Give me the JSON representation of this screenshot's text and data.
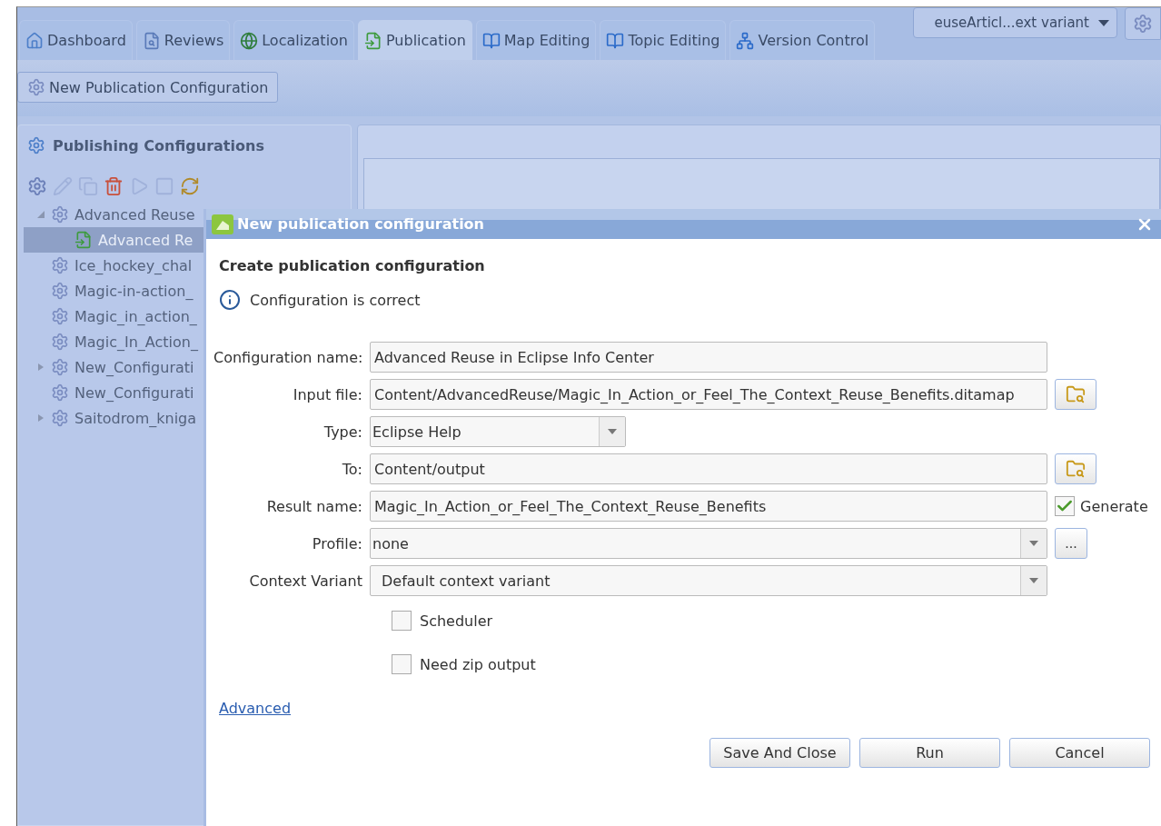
{
  "tabs": [
    {
      "label": "Dashboard",
      "kind": "home",
      "selected": false
    },
    {
      "label": "Reviews",
      "kind": "review",
      "selected": false
    },
    {
      "label": "Localization",
      "kind": "globe",
      "selected": false
    },
    {
      "label": "Publication",
      "kind": "publish",
      "selected": true
    },
    {
      "label": "Map Editing",
      "kind": "book",
      "selected": false
    },
    {
      "label": "Topic Editing",
      "kind": "book",
      "selected": false
    },
    {
      "label": "Version Control",
      "kind": "network",
      "selected": false
    }
  ],
  "context_selector": {
    "value": "euseArticl...ext variant"
  },
  "toolbar": {
    "button": "New Publication Configuration"
  },
  "panel": {
    "title": "Publishing Configurations",
    "tools": [
      {
        "kind": "add",
        "disabled": false
      },
      {
        "kind": "edit",
        "disabled": true
      },
      {
        "kind": "copy",
        "disabled": true
      },
      {
        "kind": "delete",
        "disabled": false
      },
      {
        "kind": "run",
        "disabled": true
      },
      {
        "kind": "stop",
        "disabled": true
      },
      {
        "kind": "refresh",
        "disabled": false
      }
    ],
    "tree": [
      {
        "label": "Advanced Reuse",
        "kind": "group",
        "expanded": true,
        "selected": false,
        "children": [
          {
            "label": "Advanced Re",
            "kind": "output",
            "selected": true
          }
        ]
      },
      {
        "label": "Ice_hockey_chal",
        "kind": "item",
        "selected": false
      },
      {
        "label": "Magic-in-action_",
        "kind": "item",
        "selected": false
      },
      {
        "label": "Magic_in_action_",
        "kind": "item",
        "selected": false
      },
      {
        "label": "Magic_In_Action_",
        "kind": "item",
        "selected": false
      },
      {
        "label": "New_Configurati",
        "kind": "group",
        "expanded": false,
        "selected": false
      },
      {
        "label": "New_Configurati",
        "kind": "item",
        "selected": false
      },
      {
        "label": "Saitodrom_kniga",
        "kind": "group",
        "expanded": false,
        "selected": false
      }
    ]
  },
  "dialog": {
    "title": "New publication configuration",
    "heading": "Create publication configuration",
    "message": "Configuration is correct",
    "fields": [
      {
        "label": "Configuration name:",
        "kind": "text",
        "value": "Advanced Reuse in Eclipse Info Center"
      },
      {
        "label": "Input file:",
        "kind": "browse",
        "value": "Content/AdvancedReuse/Magic_In_Action_or_Feel_The_Context_Reuse_Benefits.ditamap"
      },
      {
        "label": "Type:",
        "kind": "short-select",
        "value": "Eclipse Help"
      },
      {
        "label": "To:",
        "kind": "browse",
        "value": "Content/output"
      },
      {
        "label": "Result name:",
        "kind": "generate",
        "value": "Magic_In_Action_or_Feel_The_Context_Reuse_Benefits",
        "option": {
          "label": "Generate",
          "checked": true
        }
      },
      {
        "label": "Profile:",
        "kind": "select-more",
        "value": "none",
        "more": "..."
      },
      {
        "label": "Context Variant",
        "kind": "select",
        "value": "Default context variant"
      }
    ],
    "options": [
      {
        "label": "Scheduler",
        "checked": false
      },
      {
        "label": "Need zip output",
        "checked": false
      }
    ],
    "link": "Advanced",
    "buttons": [
      "Save And Close",
      "Run",
      "Cancel"
    ]
  }
}
